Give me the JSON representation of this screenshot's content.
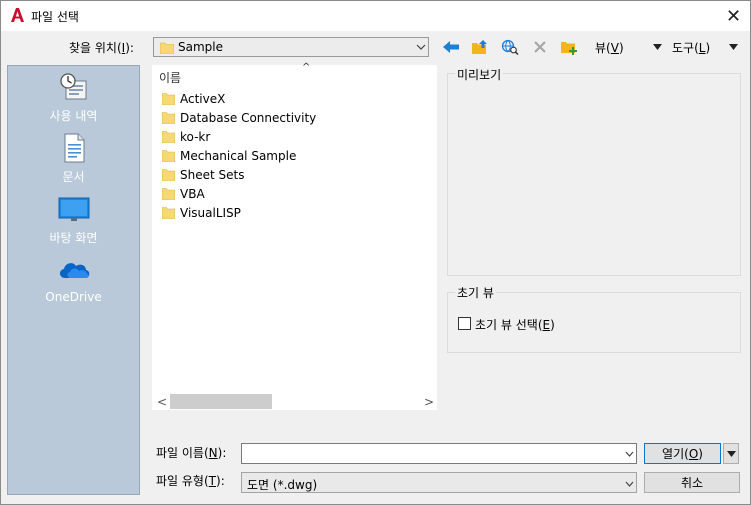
{
  "window": {
    "title": "파일 선택",
    "close_symbol": "✕"
  },
  "lookin": {
    "label": "찾을 위치(",
    "mnemonic": "I",
    "label_end": "):",
    "value": "Sample"
  },
  "toolbar": {
    "view_label": "뷰(",
    "view_mnemonic": "V",
    "view_end": ")",
    "tools_label": "도구(",
    "tools_mnemonic": "L",
    "tools_end": ")",
    "icons": [
      "back-arrow-icon",
      "up-folder-icon",
      "search-web-icon",
      "delete-icon",
      "new-folder-icon"
    ]
  },
  "places": [
    {
      "label": "사용 내역",
      "icon": "history-icon"
    },
    {
      "label": "문서",
      "icon": "documents-icon"
    },
    {
      "label": "바탕 화면",
      "icon": "desktop-icon"
    },
    {
      "label": "OneDrive",
      "icon": "onedrive-icon"
    }
  ],
  "filelist": {
    "column_header": "이름",
    "sort_caret": "^",
    "items": [
      "ActiveX",
      "Database Connectivity",
      "ko-kr",
      "Mechanical Sample",
      "Sheet Sets",
      "VBA",
      "VisualLISP"
    ]
  },
  "scrollbar": {
    "left": "<",
    "right": ">"
  },
  "preview": {
    "label": "미리보기"
  },
  "initial_view": {
    "group_label": "초기 뷰",
    "checkbox_label": "초기 뷰 선택(",
    "mnemonic": "E",
    "label_end": ")",
    "checked": false
  },
  "filename": {
    "label": "파일 이름(",
    "mnemonic": "N",
    "label_end": "):",
    "value": ""
  },
  "filetype": {
    "label": "파일 유형(",
    "mnemonic": "T",
    "label_end": "):",
    "value": "도면 (*.dwg)"
  },
  "buttons": {
    "open": "열기(",
    "open_mnemonic": "O",
    "open_end": ")",
    "cancel": "취소"
  },
  "colors": {
    "accent_blue": "#0078d7",
    "places_bg": "#b9c9d9",
    "folder_yellow": "#f8d775",
    "app_red": "#c8102e"
  }
}
